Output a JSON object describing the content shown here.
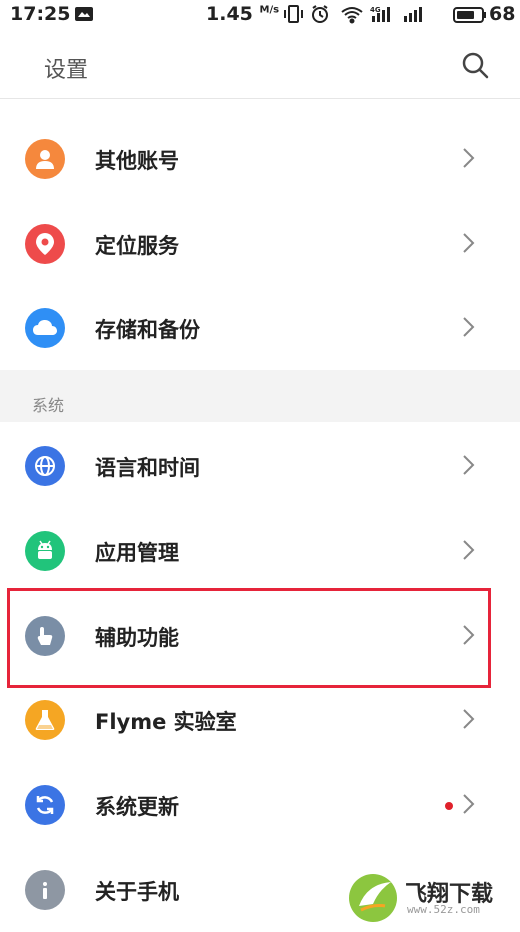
{
  "status_bar": {
    "time": "17:25",
    "net_speed": "1.45",
    "net_unit": "M/s",
    "battery_level": "68"
  },
  "header": {
    "title": "设置"
  },
  "section_top": {
    "items": [
      {
        "label": "其他账号",
        "icon": "person-icon",
        "color": "#f5883d"
      },
      {
        "label": "定位服务",
        "icon": "location-pin-icon",
        "color": "#ee4b4b"
      },
      {
        "label": "存储和备份",
        "icon": "cloud-icon",
        "color": "#2f8ff5"
      }
    ]
  },
  "section_system": {
    "title": "系统",
    "items": [
      {
        "label": "语言和时间",
        "icon": "globe-icon",
        "color": "#3b74e4"
      },
      {
        "label": "应用管理",
        "icon": "android-icon",
        "color": "#21c47b"
      },
      {
        "label": "辅助功能",
        "icon": "hand-pointer-icon",
        "color": "#7a8ea6"
      },
      {
        "label": "Flyme 实验室",
        "icon": "flask-icon",
        "color": "#f5a623"
      },
      {
        "label": "系统更新",
        "icon": "refresh-icon",
        "color": "#3b74e4",
        "has_badge": true
      },
      {
        "label": "关于手机",
        "icon": "info-icon",
        "color": "#8e97a3"
      }
    ]
  },
  "watermark": {
    "text": "飞翔下载",
    "url": "www.52z.com"
  }
}
